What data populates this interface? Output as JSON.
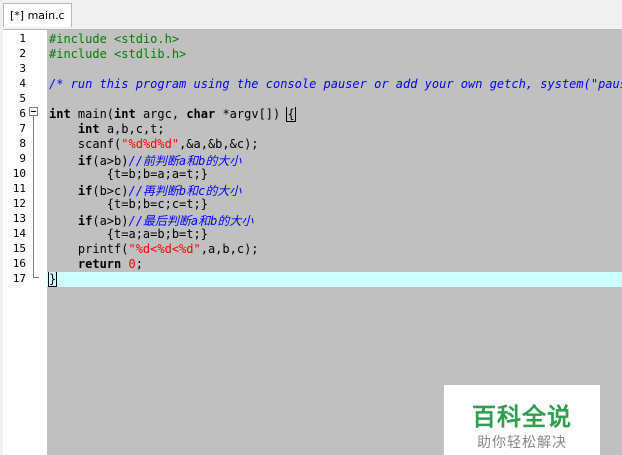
{
  "tab": {
    "label": "[*] main.c"
  },
  "line_numbers": [
    "1",
    "2",
    "3",
    "4",
    "5",
    "6",
    "7",
    "8",
    "9",
    "10",
    "11",
    "12",
    "13",
    "14",
    "15",
    "16",
    "17"
  ],
  "code": {
    "l1": "#include <stdio.h>",
    "l2": "#include <stdlib.h>",
    "l4": "/* run this program using the console pauser or add your own getch, system(\"pause\")",
    "l6_kw1": "int",
    "l6_a": " main(",
    "l6_kw2": "int",
    "l6_b": " argc, ",
    "l6_kw3": "char",
    "l6_c": " *argv[]) ",
    "l6_brace": "{",
    "l7_kw": "int",
    "l7_rest": " a,b,c,t;",
    "l8_a": "scanf(",
    "l8_str": "\"%d%d%d\"",
    "l8_b": ",&a,&b,&c);",
    "l9_kw": "if",
    "l9_a": "(a>b)",
    "l9_cm": "//前判断a和b的大小",
    "l10": "{t=b;b=a;a=t;}",
    "l11_kw": "if",
    "l11_a": "(b>c)",
    "l11_cm": "//再判断b和c的大小",
    "l12": "{t=b;b=c;c=t;}",
    "l13_kw": "if",
    "l13_a": "(a>b)",
    "l13_cm": "//最后判断a和b的大小",
    "l14": "{t=a;a=b;b=t;}",
    "l15_a": "printf(",
    "l15_str": "\"%d<%d<%d\"",
    "l15_b": ",a,b,c);",
    "l16_kw": "return",
    "l16_num": "0",
    "l16_b": ";",
    "l17": "}"
  },
  "watermark": {
    "main": "百科全说",
    "sub": "助你轻松解决"
  },
  "colors": {
    "code_background": "#c0c0c0",
    "active_line": "#ccffff",
    "preprocessor": "#008000",
    "comment": "#0000ff",
    "string": "#ff0000",
    "watermark_green": "#2e9e4f"
  }
}
